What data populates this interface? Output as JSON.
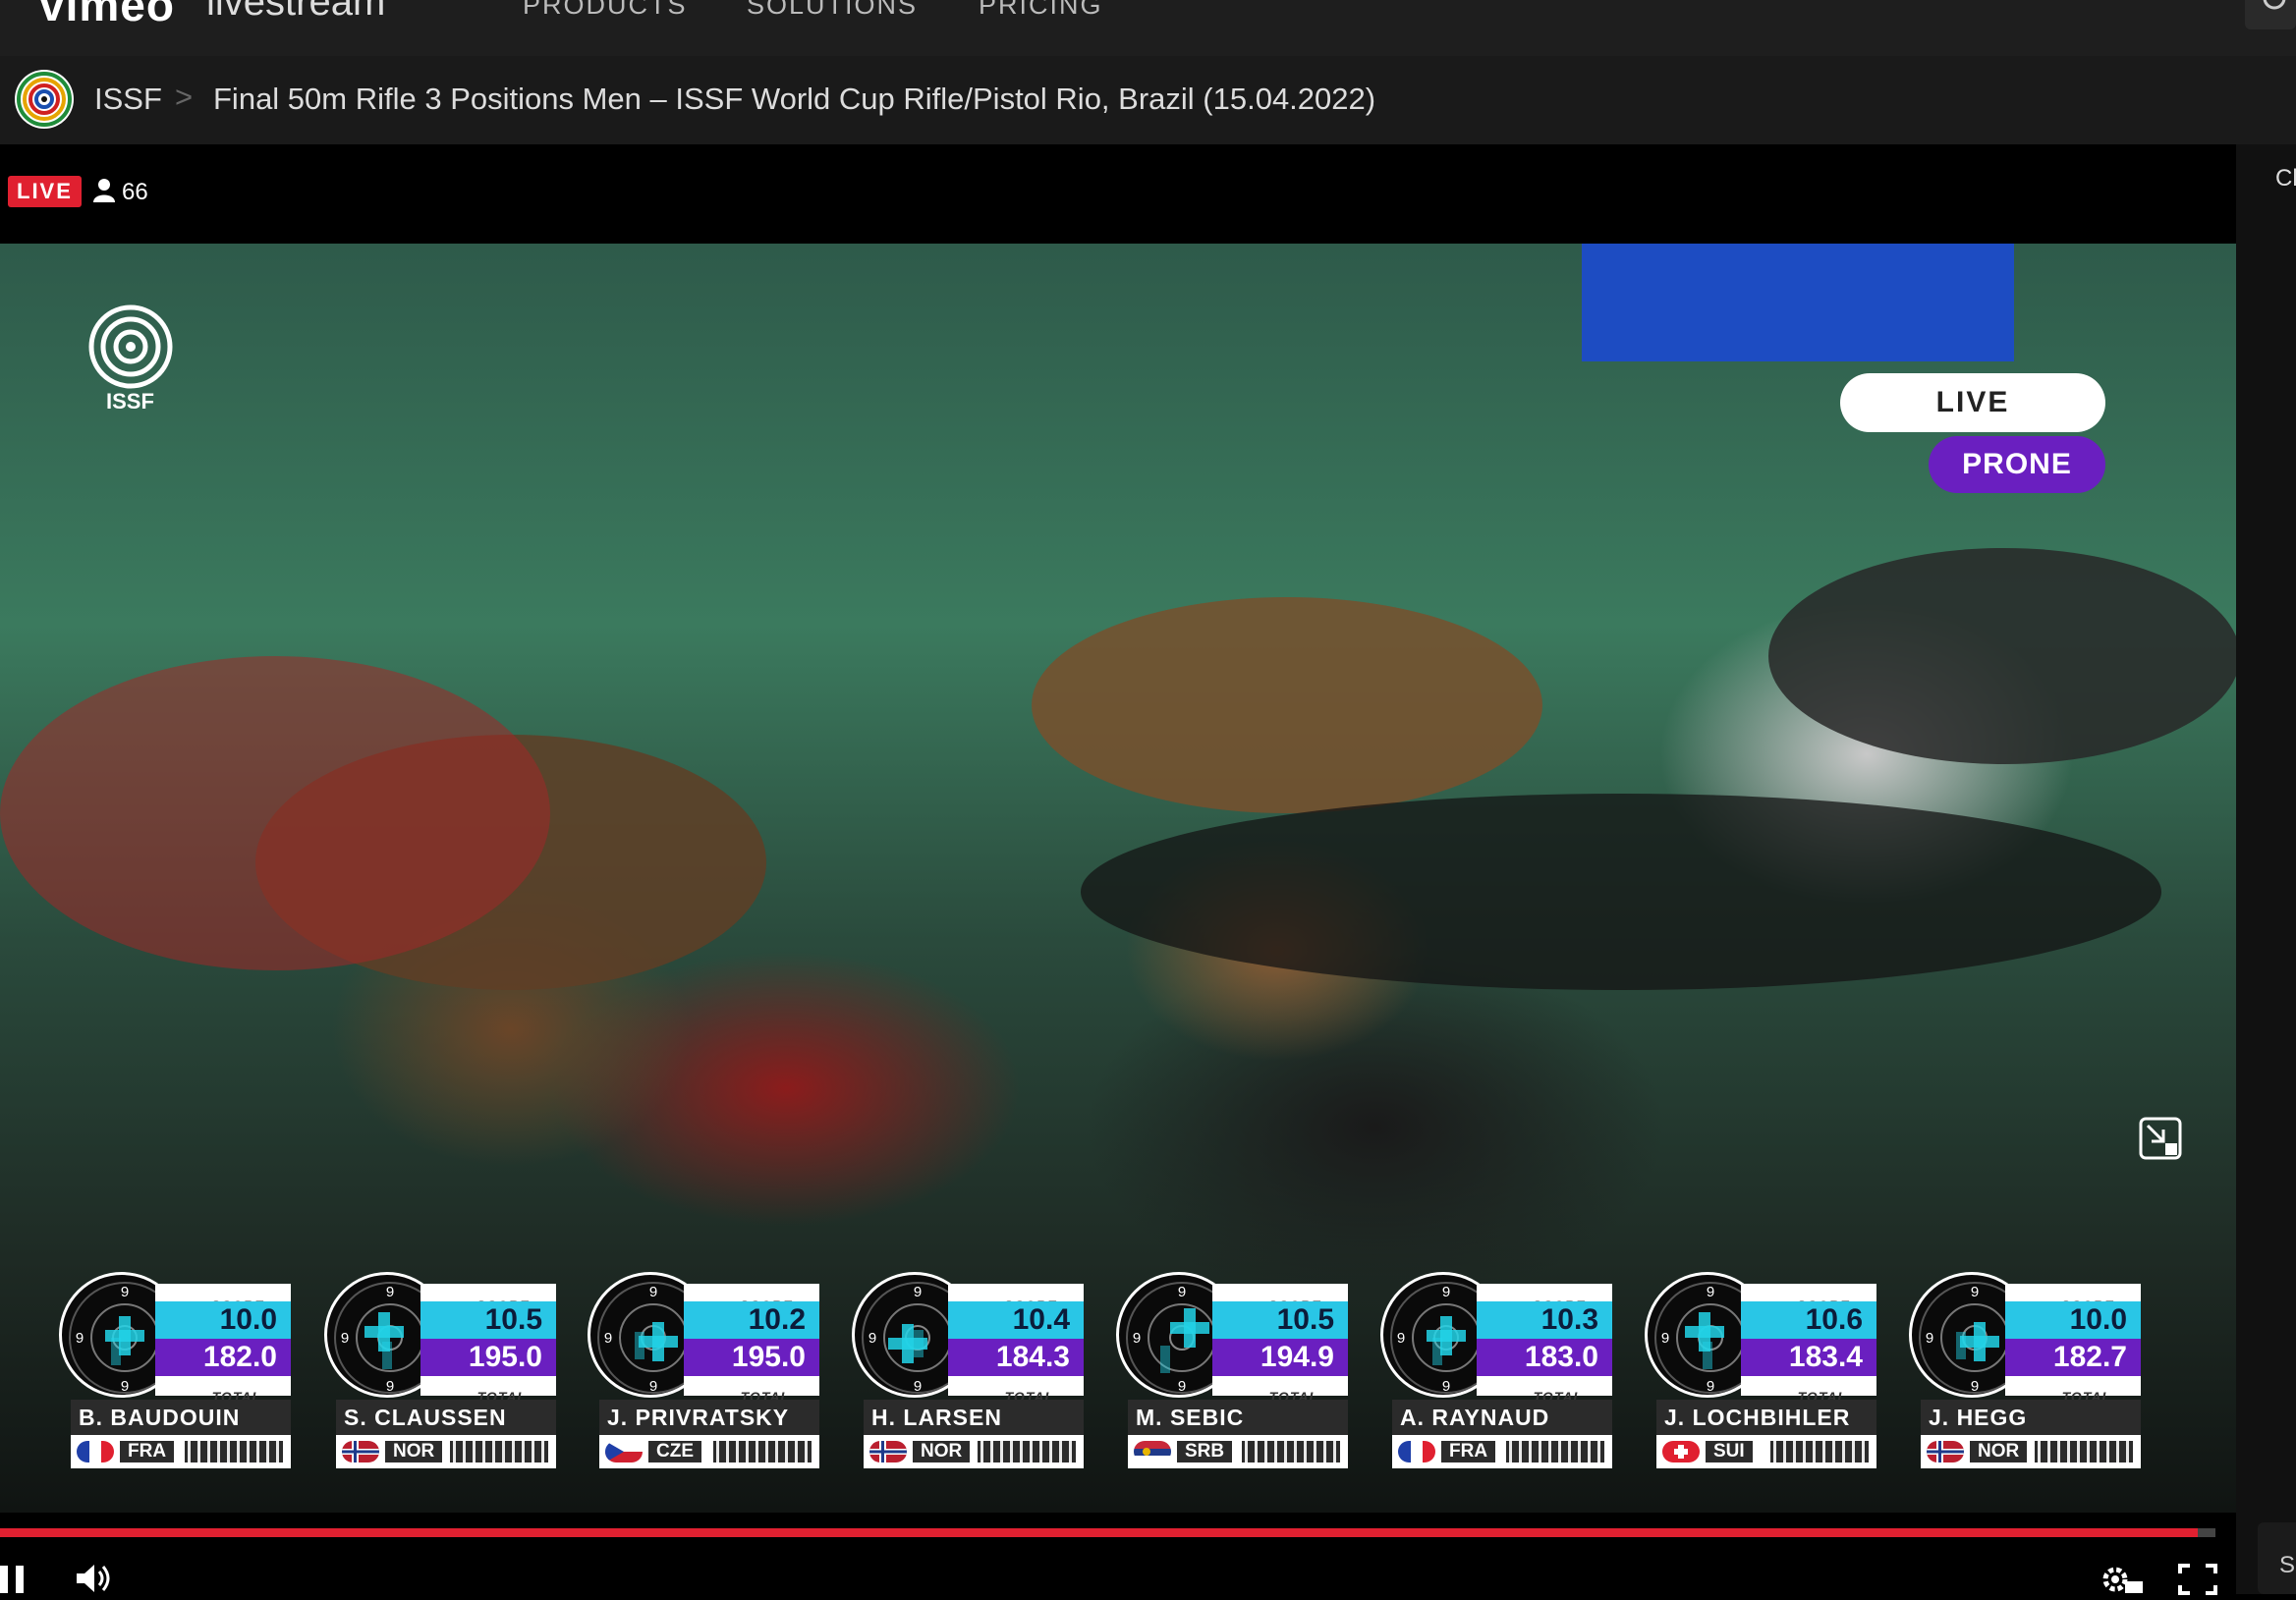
{
  "nav": {
    "brand": "vimeo",
    "brand_sub": "livestream",
    "links": [
      "PRODUCTS",
      "SOLUTIONS",
      "PRICING"
    ]
  },
  "breadcrumb": {
    "channel": "ISSF",
    "separator": ">",
    "title": "Final 50m Rifle 3 Positions Men – ISSF World Cup Rifle/Pistol Rio, Brazil (15.04.2022)"
  },
  "player": {
    "live_label": "LIVE",
    "viewer_count": "66",
    "overlay_logo": "ISSF",
    "overlay_live": "LIVE",
    "overlay_stage": "PRONE",
    "progress": 0.992
  },
  "side_panel": {
    "tab_label": "Cl",
    "bottom_label": "S"
  },
  "scoreboard": {
    "score_label": "SCORE",
    "total_label": "TOTAL",
    "ring_label": "9",
    "athletes": [
      {
        "name": "B. BAUDOUIN",
        "country": "FRA",
        "score": "10.0",
        "total": "182.0"
      },
      {
        "name": "S. CLAUSSEN",
        "country": "NOR",
        "score": "10.5",
        "total": "195.0"
      },
      {
        "name": "J. PRIVRATSKY",
        "country": "CZE",
        "score": "10.2",
        "total": "195.0"
      },
      {
        "name": "H. LARSEN",
        "country": "NOR",
        "score": "10.4",
        "total": "184.3"
      },
      {
        "name": "M. SEBIC",
        "country": "SRB",
        "score": "10.5",
        "total": "194.9"
      },
      {
        "name": "A. RAYNAUD",
        "country": "FRA",
        "score": "10.3",
        "total": "183.0"
      },
      {
        "name": "J. LOCHBIHLER",
        "country": "SUI",
        "score": "10.6",
        "total": "183.4"
      },
      {
        "name": "J. HEGG",
        "country": "NOR",
        "score": "10.0",
        "total": "182.7"
      }
    ]
  },
  "colors": {
    "accent_red": "#e02030",
    "score_cyan": "#29c6e6",
    "total_purple": "#6a1fc0"
  },
  "icons": [
    "search-icon",
    "user-icon",
    "minimize-icon",
    "pause-icon",
    "volume-icon",
    "settings-hd-icon",
    "fullscreen-icon"
  ]
}
